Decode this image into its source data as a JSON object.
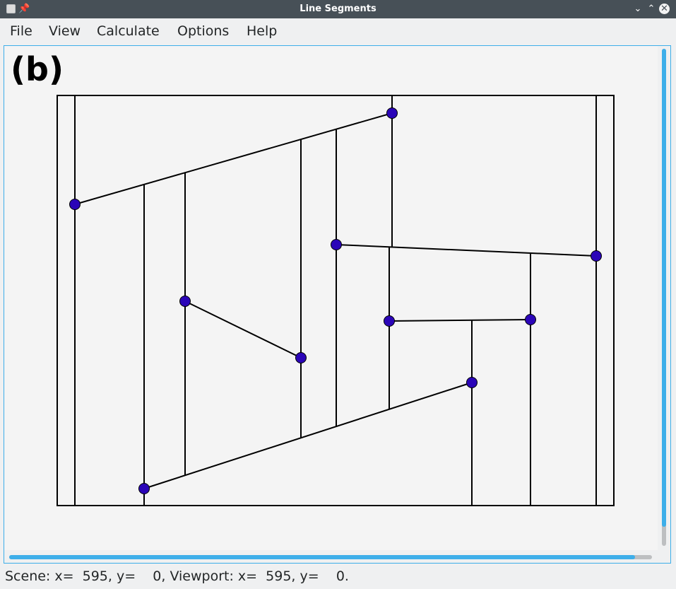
{
  "window": {
    "title": "Line Segments"
  },
  "menu": {
    "file": "File",
    "view": "View",
    "calculate": "Calculate",
    "options": "Options",
    "help": "Help"
  },
  "scene": {
    "label": "(b)"
  },
  "status": {
    "text": "Scene: x=  595, y=    0, Viewport: x=  595, y=    0."
  },
  "colors": {
    "accent": "#3daee9",
    "titlebar": "#475057",
    "point_fill": "#2b05b8"
  },
  "icons": {
    "app": "window-icon",
    "pin": "pin-icon",
    "minimize": "chevron-down-icon",
    "maximize": "chevron-up-icon",
    "close": "close-icon"
  }
}
